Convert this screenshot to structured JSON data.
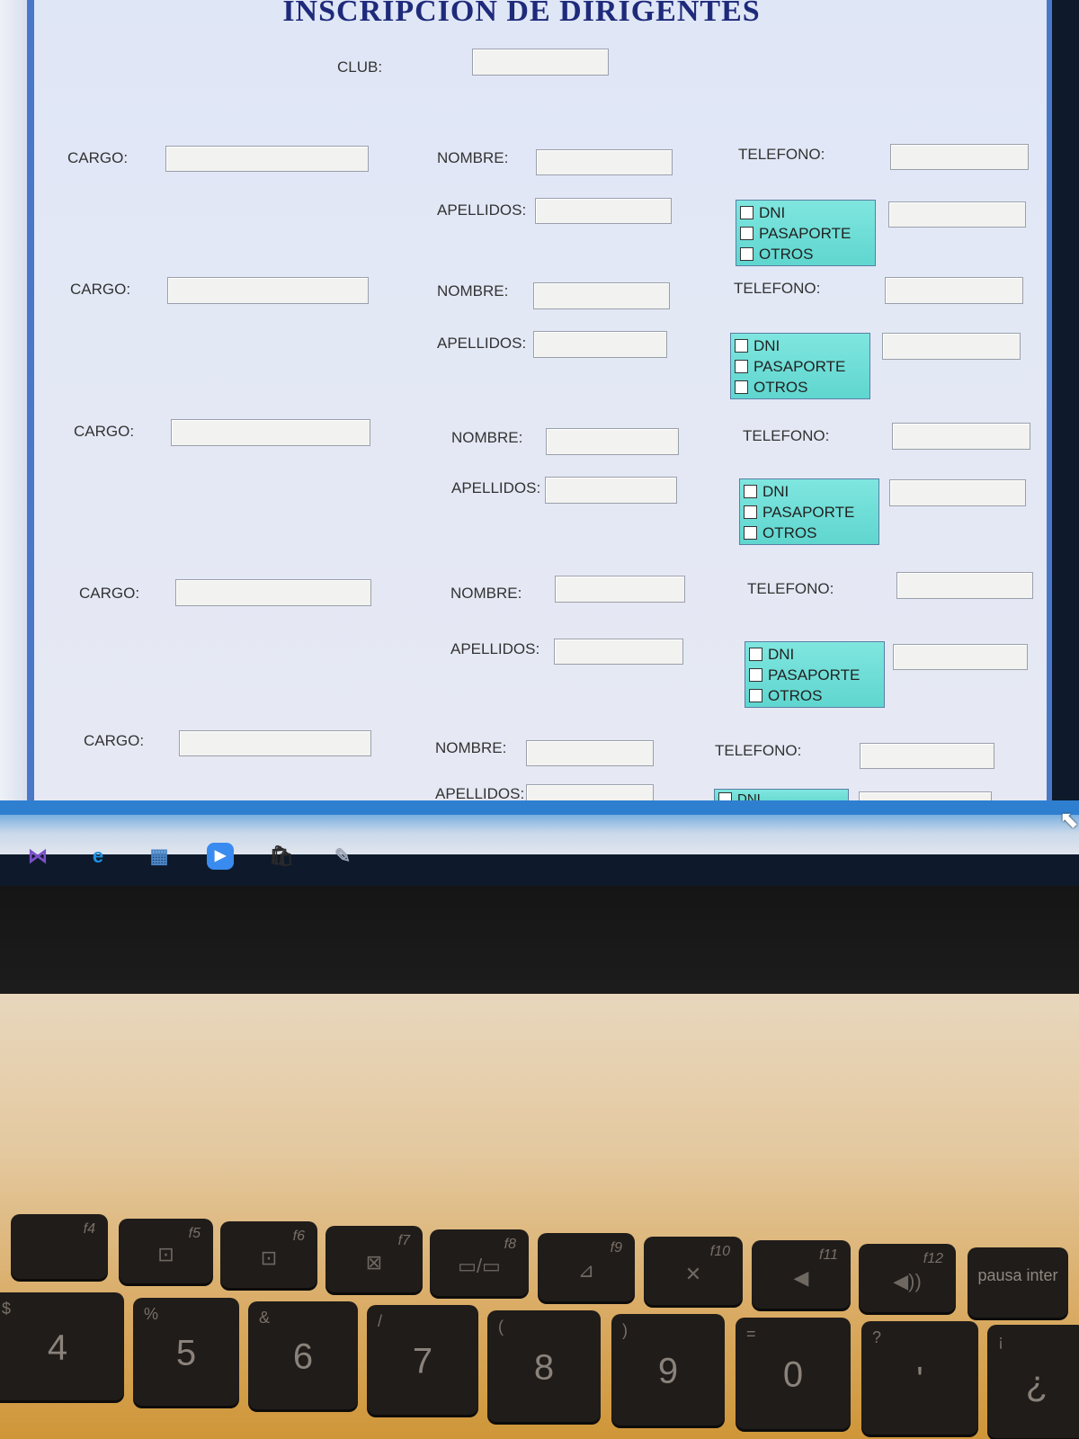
{
  "form": {
    "title": "INSCRIPCION DE DIRIGENTES",
    "club_label": "CLUB:",
    "club_value": "",
    "rows": [
      {
        "cargo_label": "CARGO:",
        "nombre_label": "NOMBRE:",
        "apellidos_label": "APELLIDOS:",
        "telefono_label": "TELEFONO:",
        "documents": [
          "DNI",
          "PASAPORTE",
          "OTROS"
        ]
      },
      {
        "cargo_label": "CARGO:",
        "nombre_label": "NOMBRE:",
        "apellidos_label": "APELLIDOS:",
        "telefono_label": "TELEFONO:",
        "documents": [
          "DNI",
          "PASAPORTE",
          "OTROS"
        ]
      },
      {
        "cargo_label": "CARGO:",
        "nombre_label": "NOMBRE:",
        "apellidos_label": "APELLIDOS:",
        "telefono_label": "TELEFONO:",
        "documents": [
          "DNI",
          "PASAPORTE",
          "OTROS"
        ]
      },
      {
        "cargo_label": "CARGO:",
        "nombre_label": "NOMBRE:",
        "apellidos_label": "APELLIDOS:",
        "telefono_label": "TELEFONO:",
        "documents": [
          "DNI",
          "PASAPORTE",
          "OTROS"
        ]
      },
      {
        "cargo_label": "CARGO:",
        "nombre_label": "NOMBRE:",
        "apellidos_label": "APELLIDOS:",
        "telefono_label": "TELEFONO:",
        "documents": [
          "DNI"
        ]
      }
    ]
  },
  "taskbar": {
    "icons": [
      "visual-studio-icon",
      "edge-icon",
      "file-explorer-icon",
      "zoom-icon",
      "store-icon",
      "paint-icon"
    ]
  },
  "keyboard": {
    "function_keys": [
      {
        "fn": "f4",
        "glyph": ""
      },
      {
        "fn": "f5",
        "glyph": "⊡"
      },
      {
        "fn": "f6",
        "glyph": "⊡"
      },
      {
        "fn": "f7",
        "glyph": "⊠"
      },
      {
        "fn": "f8",
        "glyph": "▭/▭"
      },
      {
        "fn": "f9",
        "glyph": "⊿"
      },
      {
        "fn": "f10",
        "glyph": "✕"
      },
      {
        "fn": "f11",
        "glyph": "◀"
      },
      {
        "fn": "f12",
        "glyph": "◀))"
      },
      {
        "fn": "",
        "glyph": "pausa inter"
      }
    ],
    "number_keys": [
      {
        "main": "4",
        "sym": "$"
      },
      {
        "main": "5",
        "sym": "%"
      },
      {
        "main": "6",
        "sym": "&"
      },
      {
        "main": "7",
        "sym": "/"
      },
      {
        "main": "8",
        "sym": "("
      },
      {
        "main": "9",
        "sym": ")"
      },
      {
        "main": "0",
        "sym": "="
      },
      {
        "main": "'",
        "sym": "?"
      },
      {
        "main": "¿",
        "sym": "¡"
      }
    ]
  }
}
